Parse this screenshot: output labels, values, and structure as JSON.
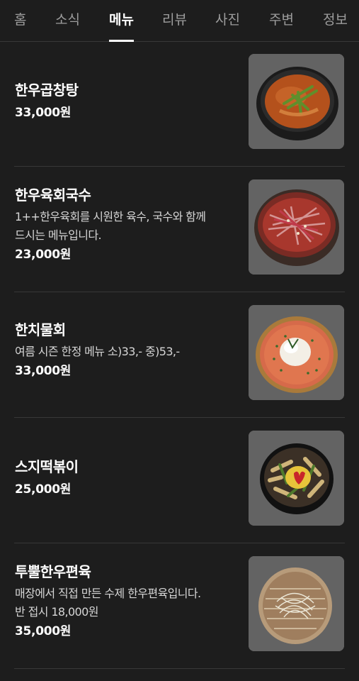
{
  "tabs": [
    {
      "label": "홈"
    },
    {
      "label": "소식"
    },
    {
      "label": "메뉴"
    },
    {
      "label": "리뷰"
    },
    {
      "label": "사진"
    },
    {
      "label": "주변"
    },
    {
      "label": "정보"
    }
  ],
  "active_tab": "메뉴",
  "menu": [
    {
      "name": "한우곱창탕",
      "description": [],
      "price": "33,000원",
      "image_icon": "beef-tripe-soup-photo"
    },
    {
      "name": "한우육회국수",
      "description": [
        "1++한우육회를 시원한 육수, 국수와 함께",
        "드시는 메뉴입니다."
      ],
      "price": "23,000원",
      "image_icon": "beef-tartare-noodle-photo"
    },
    {
      "name": "한치물회",
      "description": [
        "여름 시즌 한정 메뉴 소)33,- 중)53,-"
      ],
      "price": "33,000원",
      "image_icon": "squid-cold-soup-photo"
    },
    {
      "name": "스지떡볶이",
      "description": [],
      "price": "25,000원",
      "image_icon": "tendon-tteokbokki-photo"
    },
    {
      "name": "투뿔한우편육",
      "description": [
        "매장에서 직접 만든 수제 한우편육입니다.",
        "반 접시 18,000원"
      ],
      "price": "35,000원",
      "image_icon": "sliced-boiled-beef-photo"
    }
  ],
  "colors": {
    "background": "#1d1d1d",
    "divider": "#383838",
    "tab_inactive": "#9d9d9d",
    "text_primary": "#ffffff",
    "text_secondary": "#d6d6d6"
  }
}
